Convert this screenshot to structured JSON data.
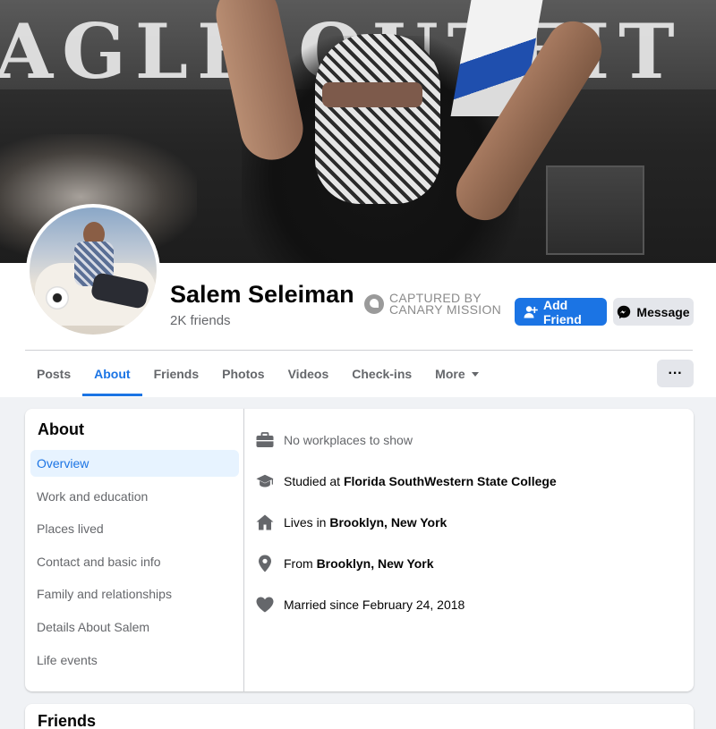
{
  "cover": {
    "sign_text": "AGLE OUTFIT"
  },
  "profile": {
    "name": "Salem Seleiman",
    "friends_count": "2K friends",
    "watermark_line1": "CAPTURED BY",
    "watermark_line2": "CANARY MISSION"
  },
  "actions": {
    "add_friend_label": "Add Friend",
    "message_label": "Message",
    "more_actions_label": "···"
  },
  "tabs": [
    {
      "label": "Posts"
    },
    {
      "label": "About"
    },
    {
      "label": "Friends"
    },
    {
      "label": "Photos"
    },
    {
      "label": "Videos"
    },
    {
      "label": "Check-ins"
    },
    {
      "label": "More"
    }
  ],
  "about": {
    "title": "About",
    "nav": [
      {
        "label": "Overview"
      },
      {
        "label": "Work and education"
      },
      {
        "label": "Places lived"
      },
      {
        "label": "Contact and basic info"
      },
      {
        "label": "Family and relationships"
      },
      {
        "label": "Details About Salem"
      },
      {
        "label": "Life events"
      }
    ],
    "overview": [
      {
        "icon": "briefcase-icon",
        "prefix": "No workplaces to show",
        "value": ""
      },
      {
        "icon": "graduation-cap-icon",
        "prefix": "Studied at ",
        "value": "Florida SouthWestern State College"
      },
      {
        "icon": "home-icon",
        "prefix": "Lives in ",
        "value": "Brooklyn, New York"
      },
      {
        "icon": "location-pin-icon",
        "prefix": "From ",
        "value": "Brooklyn, New York"
      },
      {
        "icon": "heart-icon",
        "prefix": "Married since February 24, 2018",
        "value": ""
      }
    ]
  },
  "friends_section": {
    "title": "Friends"
  },
  "colors": {
    "brand": "#1b74e4",
    "icon_gray": "#65676b",
    "page_bg": "#f0f2f5"
  }
}
